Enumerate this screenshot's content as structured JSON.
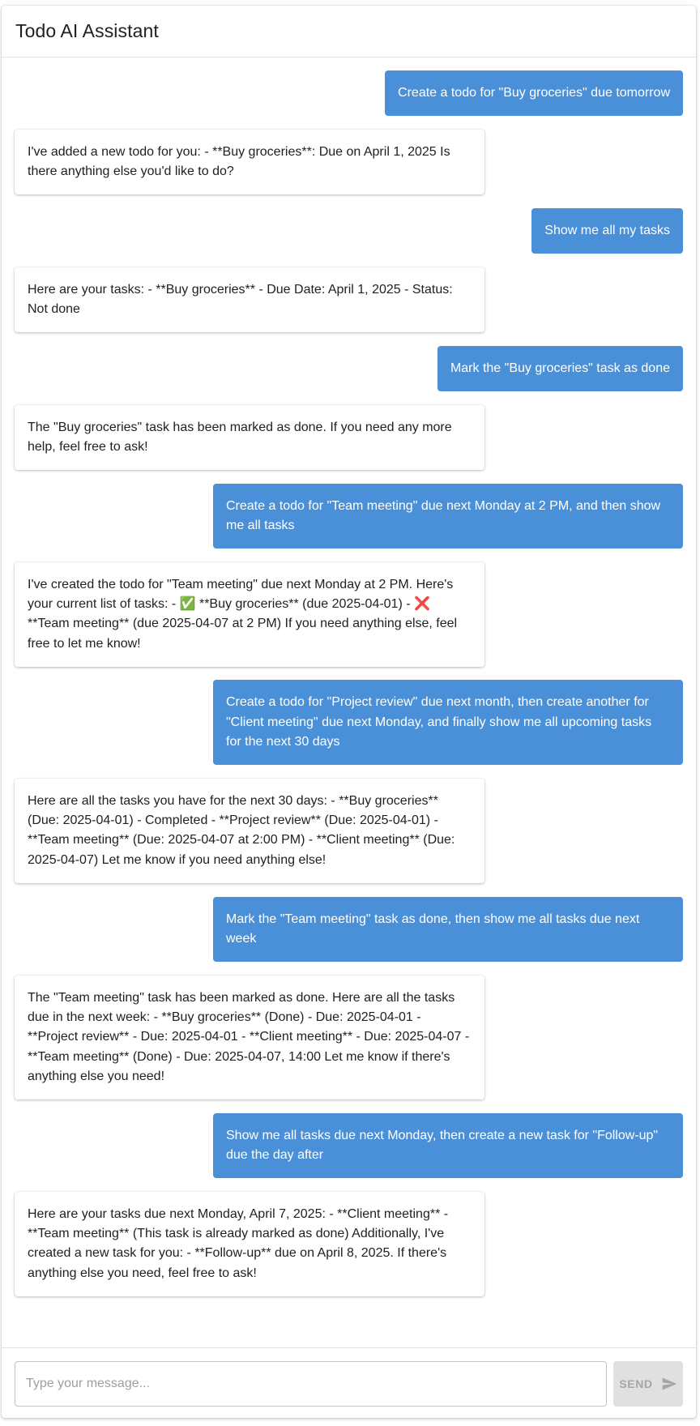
{
  "app": {
    "title": "Todo AI Assistant"
  },
  "messages": [
    {
      "role": "user",
      "text": "Create a todo for \"Buy groceries\" due tomorrow"
    },
    {
      "role": "assistant",
      "text": "I've added a new todo for you: - **Buy groceries**: Due on April 1, 2025 Is there anything else you'd like to do?"
    },
    {
      "role": "user",
      "text": "Show me all my tasks"
    },
    {
      "role": "assistant",
      "text": "Here are your tasks: - **Buy groceries** - Due Date: April 1, 2025 - Status: Not done"
    },
    {
      "role": "user",
      "text": "Mark the \"Buy groceries\" task as done"
    },
    {
      "role": "assistant",
      "text": "The \"Buy groceries\" task has been marked as done. If you need any more help, feel free to ask!"
    },
    {
      "role": "user",
      "text": "Create a todo for \"Team meeting\" due next Monday at 2 PM, and then show me all tasks"
    },
    {
      "role": "assistant",
      "text": "I've created the todo for \"Team meeting\" due next Monday at 2 PM. Here's your current list of tasks: - ✅ **Buy groceries** (due 2025-04-01) - ❌ **Team meeting** (due 2025-04-07 at 2 PM) If you need anything else, feel free to let me know!"
    },
    {
      "role": "user",
      "text": "Create a todo for \"Project review\" due next month, then create another for \"Client meeting\" due next Monday, and finally show me all upcoming tasks for the next 30 days"
    },
    {
      "role": "assistant",
      "text": "Here are all the tasks you have for the next 30 days: - **Buy groceries** (Due: 2025-04-01) - Completed - **Project review** (Due: 2025-04-01) - **Team meeting** (Due: 2025-04-07 at 2:00 PM) - **Client meeting** (Due: 2025-04-07) Let me know if you need anything else!"
    },
    {
      "role": "user",
      "text": "Mark the \"Team meeting\" task as done, then show me all tasks due next week"
    },
    {
      "role": "assistant",
      "text": "The \"Team meeting\" task has been marked as done. Here are all the tasks due in the next week: - **Buy groceries** (Done) - Due: 2025-04-01 - **Project review** - Due: 2025-04-01 - **Client meeting** - Due: 2025-04-07 - **Team meeting** (Done) - Due: 2025-04-07, 14:00 Let me know if there's anything else you need!"
    },
    {
      "role": "user",
      "text": "Show me all tasks due next Monday, then create a new task for \"Follow-up\" due the day after"
    },
    {
      "role": "assistant",
      "text": "Here are your tasks due next Monday, April 7, 2025: - **Client meeting** - **Team meeting** (This task is already marked as done) Additionally, I've created a new task for you: - **Follow-up** due on April 8, 2025. If there's anything else you need, feel free to ask!"
    }
  ],
  "composer": {
    "placeholder": "Type your message...",
    "value": "",
    "send_label": "SEND",
    "send_icon": "send-icon"
  },
  "colors": {
    "user_bubble": "#4a90d9",
    "assistant_bubble": "#ffffff",
    "send_disabled_bg": "#e0e0e0",
    "send_disabled_text": "#a6a6a6"
  }
}
